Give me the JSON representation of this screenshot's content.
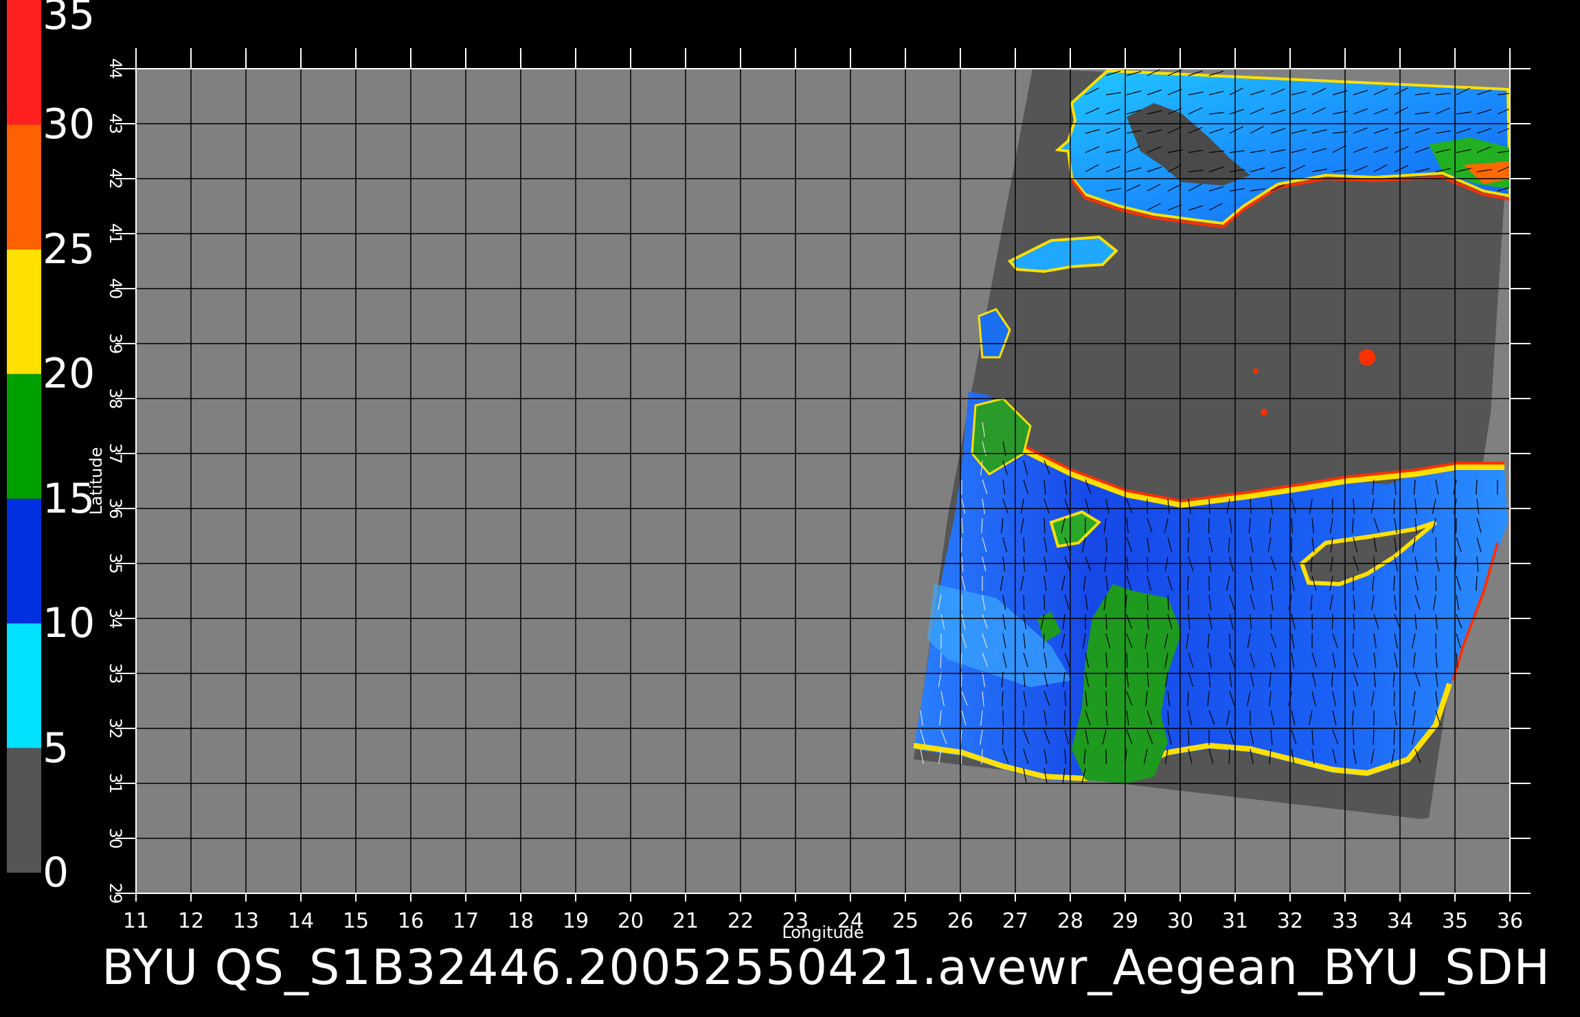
{
  "chart_data": {
    "type": "heatmap",
    "title": "BYU  QS_S1B32446.20052550421.avewr_Aegean_BYU_SDH",
    "xlabel": "Longitude",
    "ylabel": "Latitude",
    "xlim": [
      11,
      36
    ],
    "ylim": [
      29,
      44
    ],
    "x_ticks": [
      "11",
      "12",
      "13",
      "14",
      "15",
      "16",
      "17",
      "18",
      "19",
      "20",
      "21",
      "22",
      "23",
      "24",
      "25",
      "26",
      "27",
      "28",
      "29",
      "30",
      "31",
      "32",
      "33",
      "34",
      "35",
      "36"
    ],
    "y_ticks": [
      "29",
      "30",
      "31",
      "32",
      "33",
      "34",
      "35",
      "36",
      "37",
      "38",
      "39",
      "40",
      "41",
      "42",
      "43",
      "44"
    ],
    "grid": true,
    "colorbar": {
      "placement": "left",
      "ticks": [
        "0",
        "5",
        "10",
        "15",
        "20",
        "25",
        "30",
        "35"
      ],
      "range": [
        0,
        35
      ],
      "segments": [
        {
          "from": 0,
          "to": 5,
          "color": "#555555"
        },
        {
          "from": 5,
          "to": 10,
          "color": "#00e0ff"
        },
        {
          "from": 10,
          "to": 15,
          "color": "#0030e0"
        },
        {
          "from": 15,
          "to": 20,
          "color": "#00a000"
        },
        {
          "from": 20,
          "to": 25,
          "color": "#ffe000"
        },
        {
          "from": 25,
          "to": 30,
          "color": "#ff6000"
        },
        {
          "from": 30,
          "to": 35,
          "color": "#ff2020"
        }
      ]
    },
    "colors": {
      "land_mask": "#808080",
      "swath_background": "#555555",
      "black_sea": "#1aa0ff",
      "levant_sea": "#1060f0",
      "calm_area": "#1e9a1e",
      "coast_fringe": "#ffe000",
      "coast_edge": "#ff4000"
    }
  }
}
